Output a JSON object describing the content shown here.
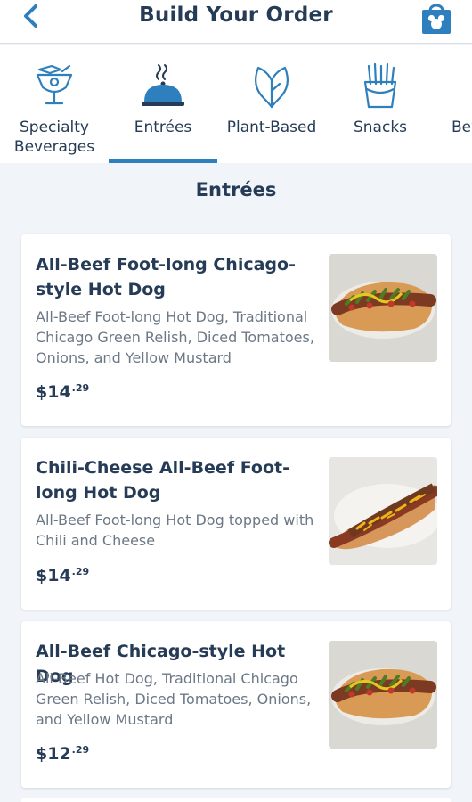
{
  "header": {
    "title": "Build Your Order",
    "back_icon": "chevron-left-icon",
    "bag_icon": "shopping-bag-icon",
    "accent": "#2e7fbd"
  },
  "tabs": [
    {
      "label_line1": "Specialty",
      "label_line2": "Beverages",
      "icon": "specialty-beverage-icon",
      "active": false
    },
    {
      "label_line1": "Entrées",
      "label_line2": "",
      "icon": "cloche-icon",
      "active": true
    },
    {
      "label_line1": "Plant-Based",
      "label_line2": "",
      "icon": "leaf-icon",
      "active": false
    },
    {
      "label_line1": "Snacks",
      "label_line2": "",
      "icon": "fries-icon",
      "active": false
    },
    {
      "label_line1": "Bev",
      "label_line2": "",
      "icon": "beverage-icon",
      "active": false
    }
  ],
  "section": {
    "title": "Entrées"
  },
  "items": [
    {
      "name": "All-Beef Foot-long Chicago-style Hot Dog",
      "description": "All-Beef Foot-long Hot Dog, Traditional Chicago Green Relish, Diced Tomatoes, Onions, and Yellow Mustard",
      "price_whole": "$14",
      "price_cents": ".29",
      "image": "chicago-hot-dog-image"
    },
    {
      "name": "Chili-Cheese All-Beef Foot-long Hot Dog",
      "description": "All-Beef Foot-long Hot Dog topped with Chili and Cheese",
      "price_whole": "$14",
      "price_cents": ".29",
      "image": "chili-cheese-hot-dog-image"
    },
    {
      "name": "All-Beef Chicago-style Hot Dog",
      "description": "All-Beef Hot Dog, Traditional Chicago Green Relish, Diced Tomatoes, Onions, and Yellow Mustard",
      "price_whole": "$12",
      "price_cents": ".29",
      "image": "chicago-hot-dog-image"
    }
  ]
}
